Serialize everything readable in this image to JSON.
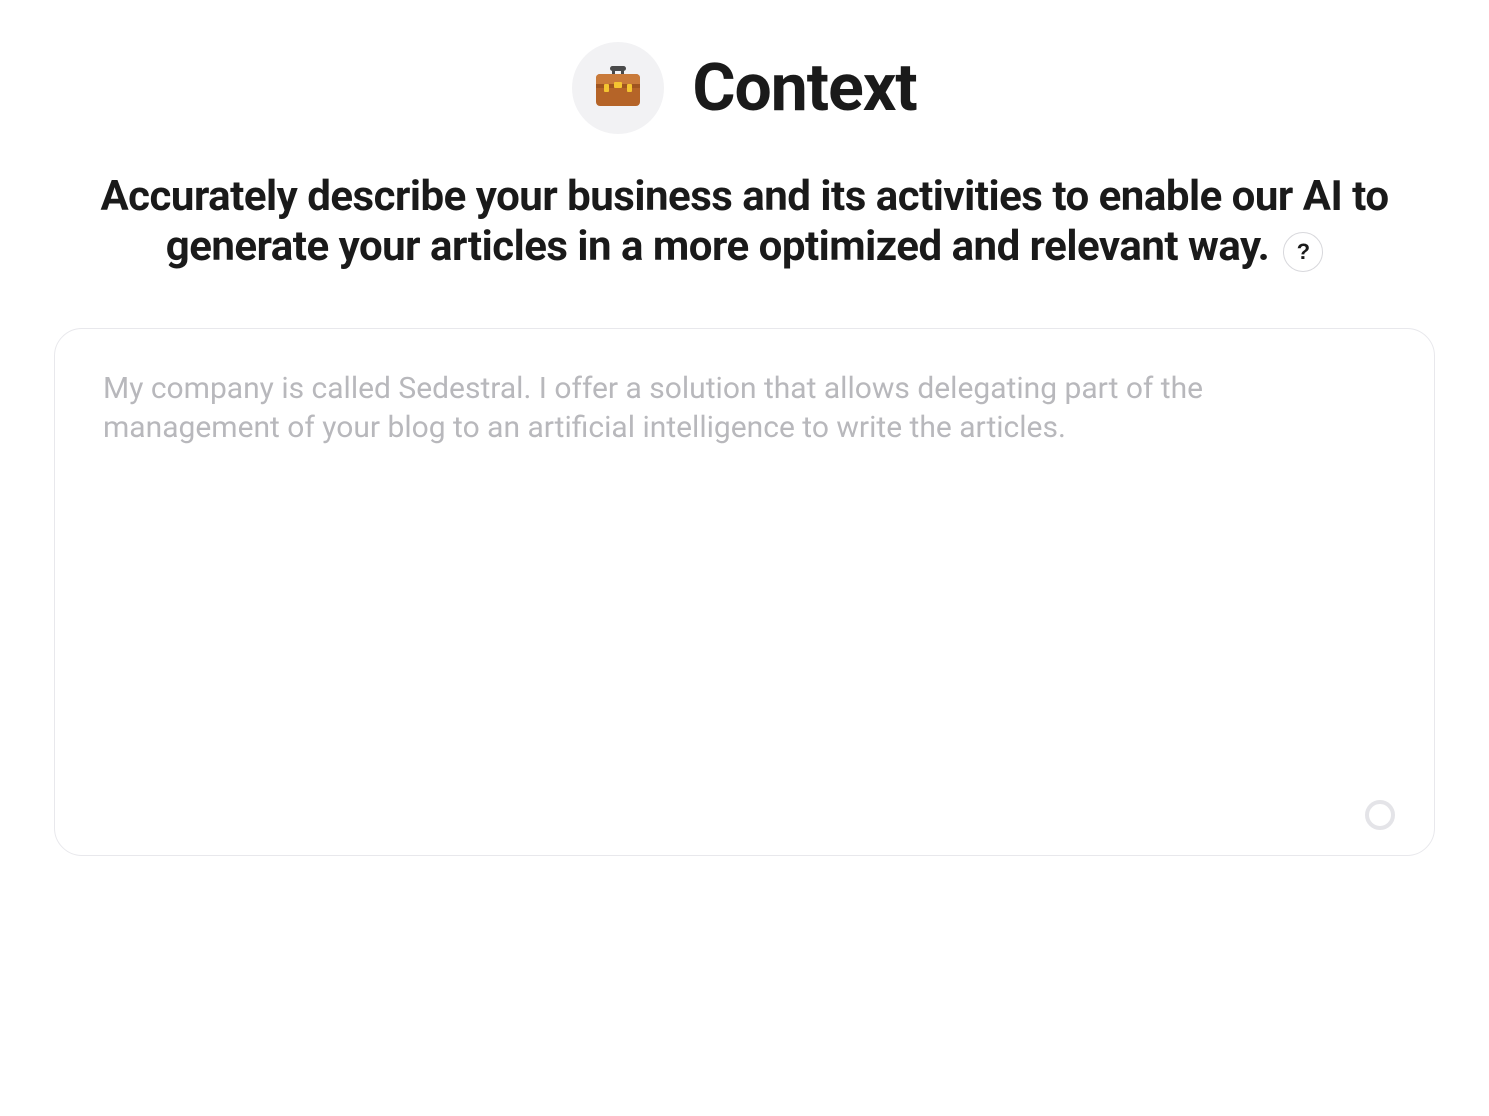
{
  "header": {
    "title": "Context",
    "icon": "briefcase-icon"
  },
  "subtitle": "Accurately describe your business and its activities to enable our AI to generate your articles in a more optimized and relevant way.",
  "help_label": "?",
  "textarea": {
    "value": "",
    "placeholder": "My company is called Sedestral. I offer a solution that allows delegating part of the management of your blog to an artificial intelligence to write the articles."
  }
}
